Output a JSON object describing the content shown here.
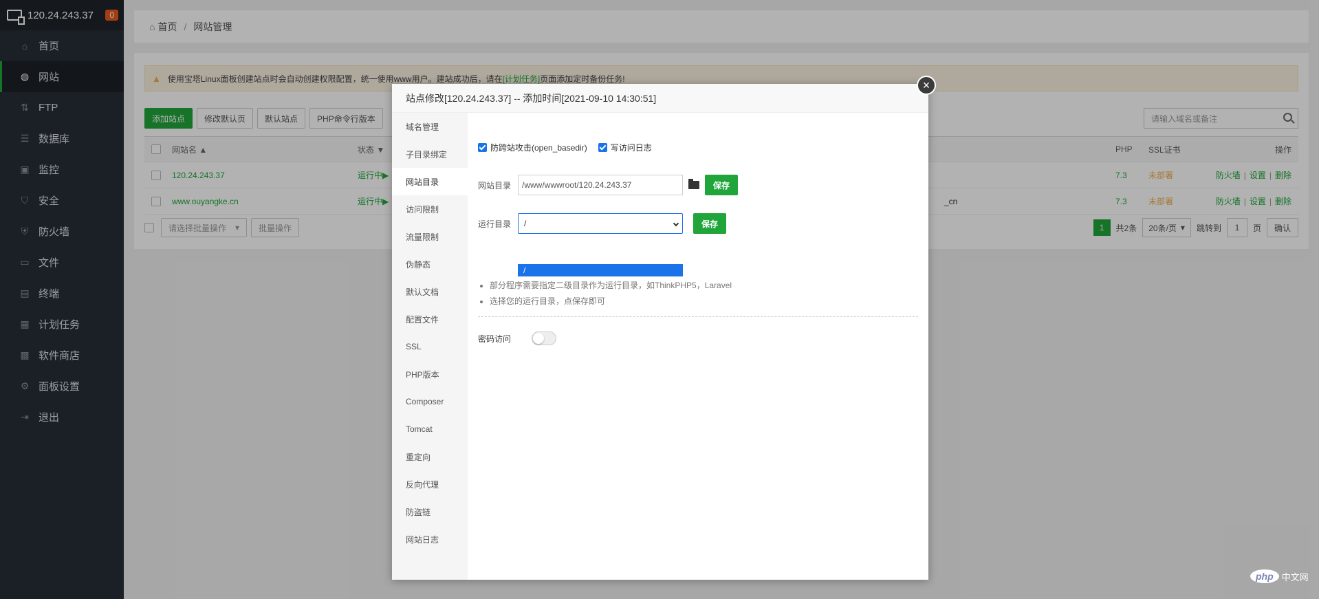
{
  "sidebar": {
    "server_ip": "120.24.243.37",
    "badge": "0",
    "items": [
      {
        "label": "首页",
        "icon": "home-icon"
      },
      {
        "label": "网站",
        "icon": "globe-icon"
      },
      {
        "label": "FTP",
        "icon": "ftp-icon"
      },
      {
        "label": "数据库",
        "icon": "database-icon"
      },
      {
        "label": "监控",
        "icon": "monitor-icon"
      },
      {
        "label": "安全",
        "icon": "shield-icon"
      },
      {
        "label": "防火墙",
        "icon": "firewall-icon"
      },
      {
        "label": "文件",
        "icon": "folder-icon"
      },
      {
        "label": "终端",
        "icon": "terminal-icon"
      },
      {
        "label": "计划任务",
        "icon": "calendar-icon"
      },
      {
        "label": "软件商店",
        "icon": "apps-icon"
      },
      {
        "label": "面板设置",
        "icon": "gear-icon"
      },
      {
        "label": "退出",
        "icon": "logout-icon"
      }
    ]
  },
  "breadcrumb": {
    "home": "首页",
    "sep": "/",
    "current": "网站管理"
  },
  "notice": {
    "text_before": "使用宝塔Linux面板创建站点时会自动创建权限配置，统一使用www用户。建站成功后，请在",
    "link": "[计划任务]",
    "text_after": "页面添加定时备份任务!"
  },
  "toolbar": {
    "add_site": "添加站点",
    "edit_default": "修改默认页",
    "default_site": "默认站点",
    "php_cli": "PHP命令行版本"
  },
  "search": {
    "placeholder": "请输入域名或备注"
  },
  "table": {
    "headers": {
      "site": "网站名 ▲",
      "status": "状态 ▼",
      "php": "PHP",
      "ssl": "SSL证书",
      "ops": "操作"
    },
    "rows": [
      {
        "site": "120.24.243.37",
        "status": "运行中▶",
        "php": "7.3",
        "ssl": "未部署",
        "extra": ""
      },
      {
        "site": "www.ouyangke.cn",
        "status": "运行中▶",
        "php": "7.3",
        "ssl": "未部署",
        "extra": "_cn"
      }
    ],
    "ops": {
      "firewall": "防火墙",
      "settings": "设置",
      "delete": "删除",
      "bar": "|"
    }
  },
  "bulk": {
    "select": "请选择批量操作",
    "apply": "批量操作"
  },
  "pager": {
    "current": "1",
    "total": "共2条",
    "per_page": "20条/页",
    "goto": "跳转到",
    "goto_page": "1",
    "page_unit": "页",
    "confirm": "确认"
  },
  "dialog": {
    "title": "站点修改[120.24.243.37] -- 添加时间[2021-09-10 14:30:51]",
    "close": "×",
    "menu": [
      "域名管理",
      "子目录绑定",
      "网站目录",
      "访问限制",
      "流量限制",
      "伪静态",
      "默认文档",
      "配置文件",
      "SSL",
      "PHP版本",
      "Composer",
      "Tomcat",
      "重定向",
      "反向代理",
      "防盗链",
      "网站日志"
    ],
    "active_index": 2,
    "anti_xss_label": "防跨站攻击(open_basedir)",
    "access_log_label": "写访问日志",
    "site_dir_label": "网站目录",
    "site_dir_value": "/www/wwwroot/120.24.243.37",
    "save": "保存",
    "run_dir_label": "运行目录",
    "run_dir_value": "/",
    "run_dir_option": "/",
    "tips": [
      "部分程序需要指定二级目录作为运行目录，如ThinkPHP5，Laravel",
      "选择您的运行目录，点保存即可"
    ],
    "password_access": "密码访问"
  },
  "watermark": {
    "logo": "php",
    "text": "中文网"
  }
}
